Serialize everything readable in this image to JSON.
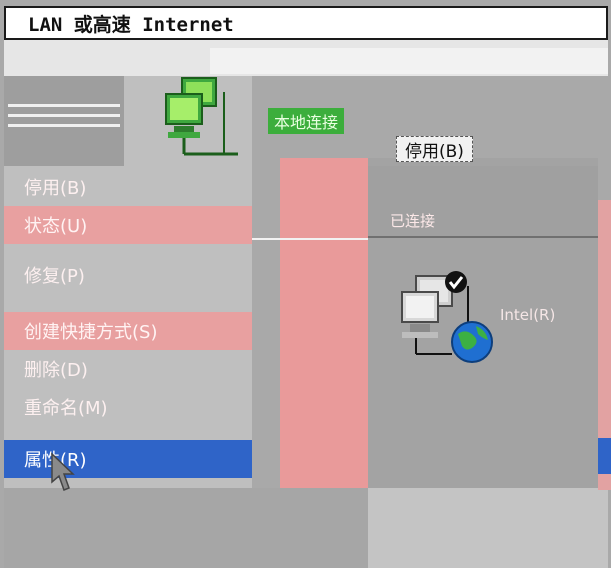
{
  "window": {
    "title": "LAN 或高速 Internet"
  },
  "connection": {
    "name": "本地连接",
    "disable_label": "停用(B)",
    "status": "已连接",
    "device": "Intel(R)"
  },
  "context_menu": {
    "items": [
      {
        "label": "停用(B)",
        "style": "grey"
      },
      {
        "label": "状态(U)",
        "style": "pink"
      },
      {
        "label": "修复(P)",
        "style": "grey"
      },
      {
        "label": "创建快捷方式(S)",
        "style": "pink"
      },
      {
        "label": "删除(D)",
        "style": "grey"
      },
      {
        "label": "重命名(M)",
        "style": "grey"
      },
      {
        "label": "属性(R)",
        "style": "selected"
      }
    ]
  },
  "colors": {
    "selection": "#2f64c8",
    "highlight_pink": "#e99a9a",
    "name_bg": "#3cae3c"
  }
}
